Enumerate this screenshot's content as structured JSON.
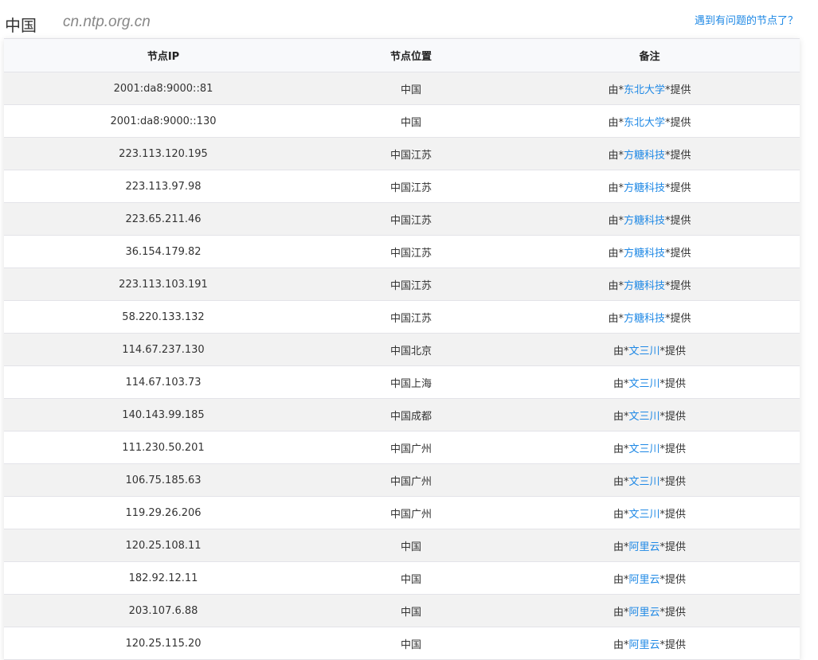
{
  "header": {
    "title": "中国",
    "domain": "cn.ntp.org.cn",
    "report_link": "遇到有问题的节点了？"
  },
  "table": {
    "columns": [
      "节点IP",
      "节点位置",
      "备注"
    ],
    "note_prefix": "由*",
    "note_suffix": "*提供",
    "rows": [
      {
        "ip": "2001:da8:9000::81",
        "location": "中国",
        "provider": "东北大学"
      },
      {
        "ip": "2001:da8:9000::130",
        "location": "中国",
        "provider": "东北大学"
      },
      {
        "ip": "223.113.120.195",
        "location": "中国江苏",
        "provider": "方糖科技"
      },
      {
        "ip": "223.113.97.98",
        "location": "中国江苏",
        "provider": "方糖科技"
      },
      {
        "ip": "223.65.211.46",
        "location": "中国江苏",
        "provider": "方糖科技"
      },
      {
        "ip": "36.154.179.82",
        "location": "中国江苏",
        "provider": "方糖科技"
      },
      {
        "ip": "223.113.103.191",
        "location": "中国江苏",
        "provider": "方糖科技"
      },
      {
        "ip": "58.220.133.132",
        "location": "中国江苏",
        "provider": "方糖科技"
      },
      {
        "ip": "114.67.237.130",
        "location": "中国北京",
        "provider": "文三川"
      },
      {
        "ip": "114.67.103.73",
        "location": "中国上海",
        "provider": "文三川"
      },
      {
        "ip": "140.143.99.185",
        "location": "中国成都",
        "provider": "文三川"
      },
      {
        "ip": "111.230.50.201",
        "location": "中国广州",
        "provider": "文三川"
      },
      {
        "ip": "106.75.185.63",
        "location": "中国广州",
        "provider": "文三川"
      },
      {
        "ip": "119.29.26.206",
        "location": "中国广州",
        "provider": "文三川"
      },
      {
        "ip": "120.25.108.11",
        "location": "中国",
        "provider": "阿里云"
      },
      {
        "ip": "182.92.12.11",
        "location": "中国",
        "provider": "阿里云"
      },
      {
        "ip": "203.107.6.88",
        "location": "中国",
        "provider": "阿里云"
      },
      {
        "ip": "120.25.115.20",
        "location": "中国",
        "provider": "阿里云"
      }
    ]
  }
}
